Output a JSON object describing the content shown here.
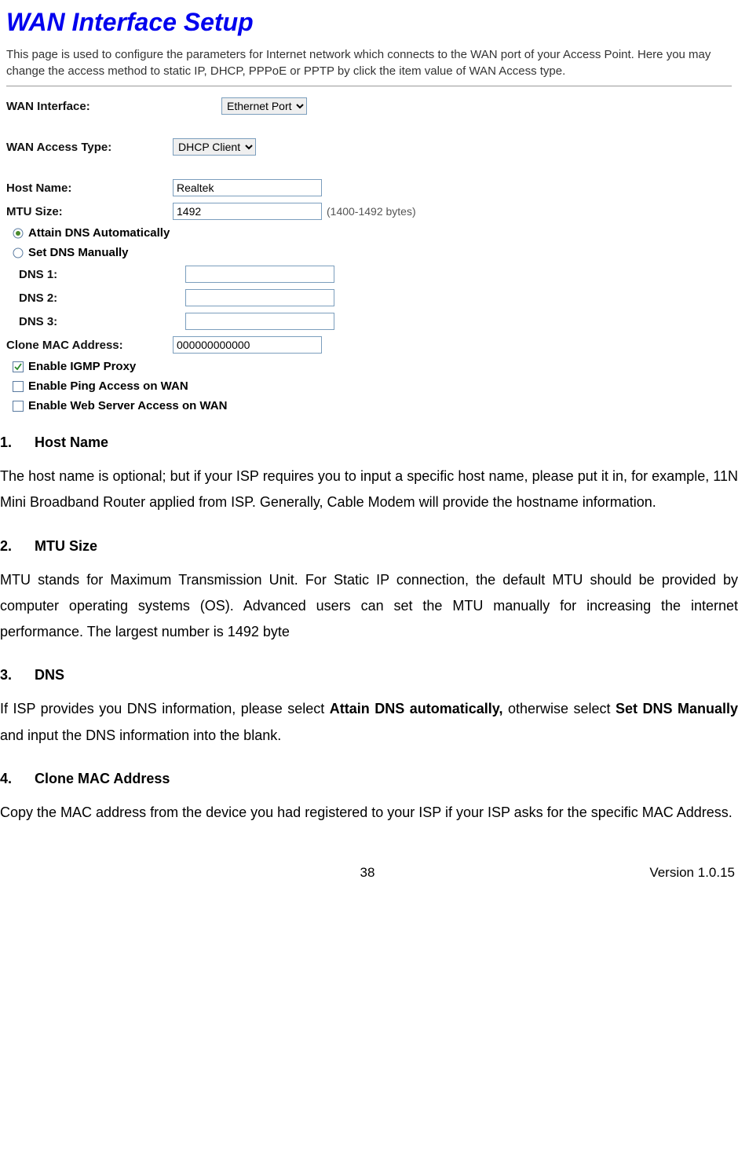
{
  "screenshot": {
    "title": "WAN Interface Setup",
    "description": "This page is used to configure the parameters for Internet network which connects to the WAN port of your Access Point. Here you may change the access method to static IP, DHCP, PPPoE or PPTP by click the item value of WAN Access type.",
    "form": {
      "wan_interface_label": "WAN Interface:",
      "wan_interface_value": "Ethernet Port",
      "wan_access_type_label": "WAN Access Type:",
      "wan_access_type_value": "DHCP Client",
      "host_name_label": "Host Name:",
      "host_name_value": "Realtek",
      "mtu_size_label": "MTU Size:",
      "mtu_size_value": "1492",
      "mtu_hint": "(1400-1492 bytes)",
      "dns_auto_label": "Attain DNS Automatically",
      "dns_manual_label": "Set DNS Manually",
      "dns1_label": "DNS 1:",
      "dns1_value": "",
      "dns2_label": "DNS 2:",
      "dns2_value": "",
      "dns3_label": "DNS 3:",
      "dns3_value": "",
      "clone_mac_label": "Clone MAC Address:",
      "clone_mac_value": "000000000000",
      "enable_igmp_label": "Enable IGMP Proxy",
      "enable_ping_label": "Enable Ping Access on WAN",
      "enable_web_label": "Enable Web Server Access on WAN"
    }
  },
  "doc": {
    "section1": {
      "heading_num": "1.",
      "heading_title": "Host Name",
      "text": "The host name is optional; but if your ISP requires you to input a specific host name, please put it in, for example, 11N Mini Broadband Router  applied from ISP. Generally, Cable Modem will provide the hostname information."
    },
    "section2": {
      "heading_num": "2.",
      "heading_title": "MTU Size",
      "text": "MTU stands for Maximum Transmission Unit. For Static IP connection, the default MTU should be provided by computer operating systems (OS).   Advanced users can set the MTU manually for increasing the internet performance. The largest number is 1492 byte"
    },
    "section3": {
      "heading_num": "3.",
      "heading_title": "DNS",
      "text_before": "If ISP provides you DNS information, please select ",
      "bold1": "Attain DNS automatically,",
      "text_mid": " otherwise select ",
      "bold2": "Set DNS Manually",
      "text_after": " and input the DNS information into the blank."
    },
    "section4": {
      "heading_num": "4.",
      "heading_title": "Clone MAC Address",
      "text": "Copy the MAC address from the device you had registered to your ISP if your ISP asks for the specific MAC Address."
    }
  },
  "footer": {
    "page_number": "38",
    "version": "Version 1.0.15"
  }
}
